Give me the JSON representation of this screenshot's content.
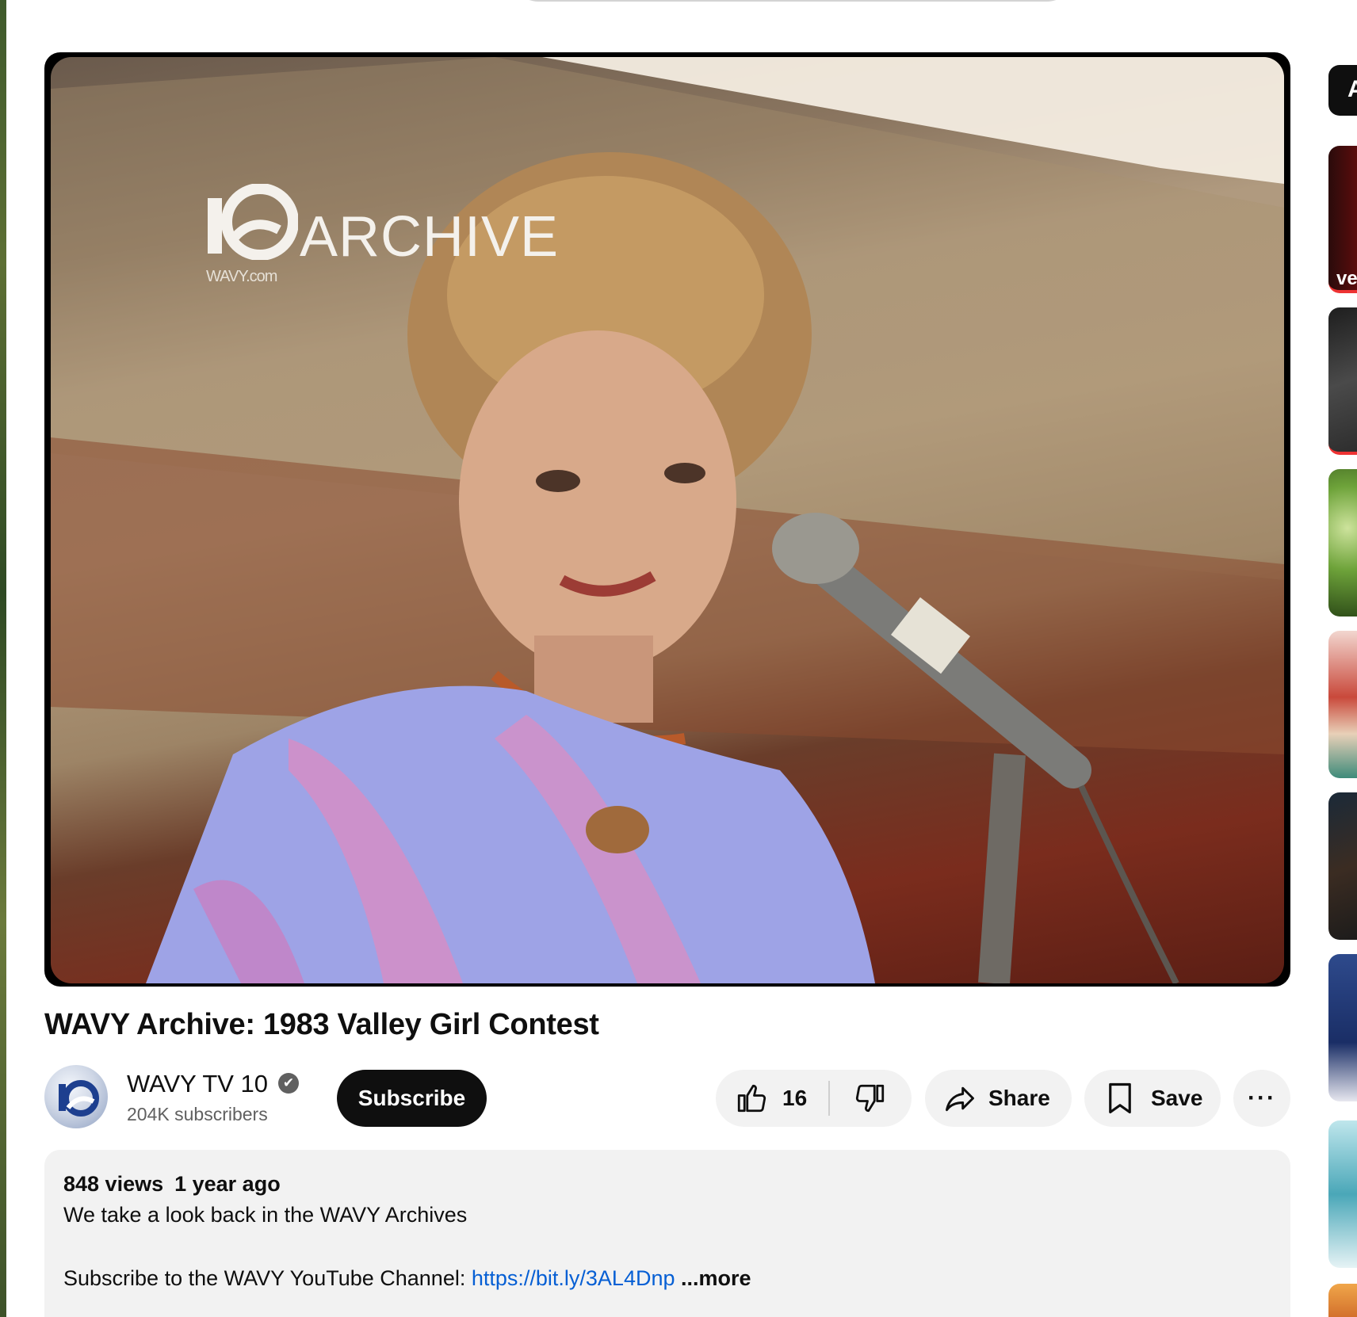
{
  "video": {
    "title": "WAVY Archive: 1983 Valley Girl Contest",
    "overlay_logo_text": "ARCHIVE",
    "overlay_logo_url": "WAVY.com"
  },
  "channel": {
    "name": "WAVY TV 10",
    "verified_icon": "✔",
    "subscribers": "204K subscribers",
    "subscribe_label": "Subscribe"
  },
  "actions": {
    "like_count": "16",
    "share_label": "Share",
    "save_label": "Save",
    "more_label": "···"
  },
  "description": {
    "views": "848 views",
    "age": "1 year ago",
    "line1": "We take a look back in the WAVY Archives",
    "line2_prefix": "Subscribe to the WAVY YouTube Channel: ",
    "link": "https://bit.ly/3AL4Dnp",
    "more": " ...more"
  },
  "right_rail": {
    "chip_label": "A",
    "thumb1_text": "ve"
  }
}
